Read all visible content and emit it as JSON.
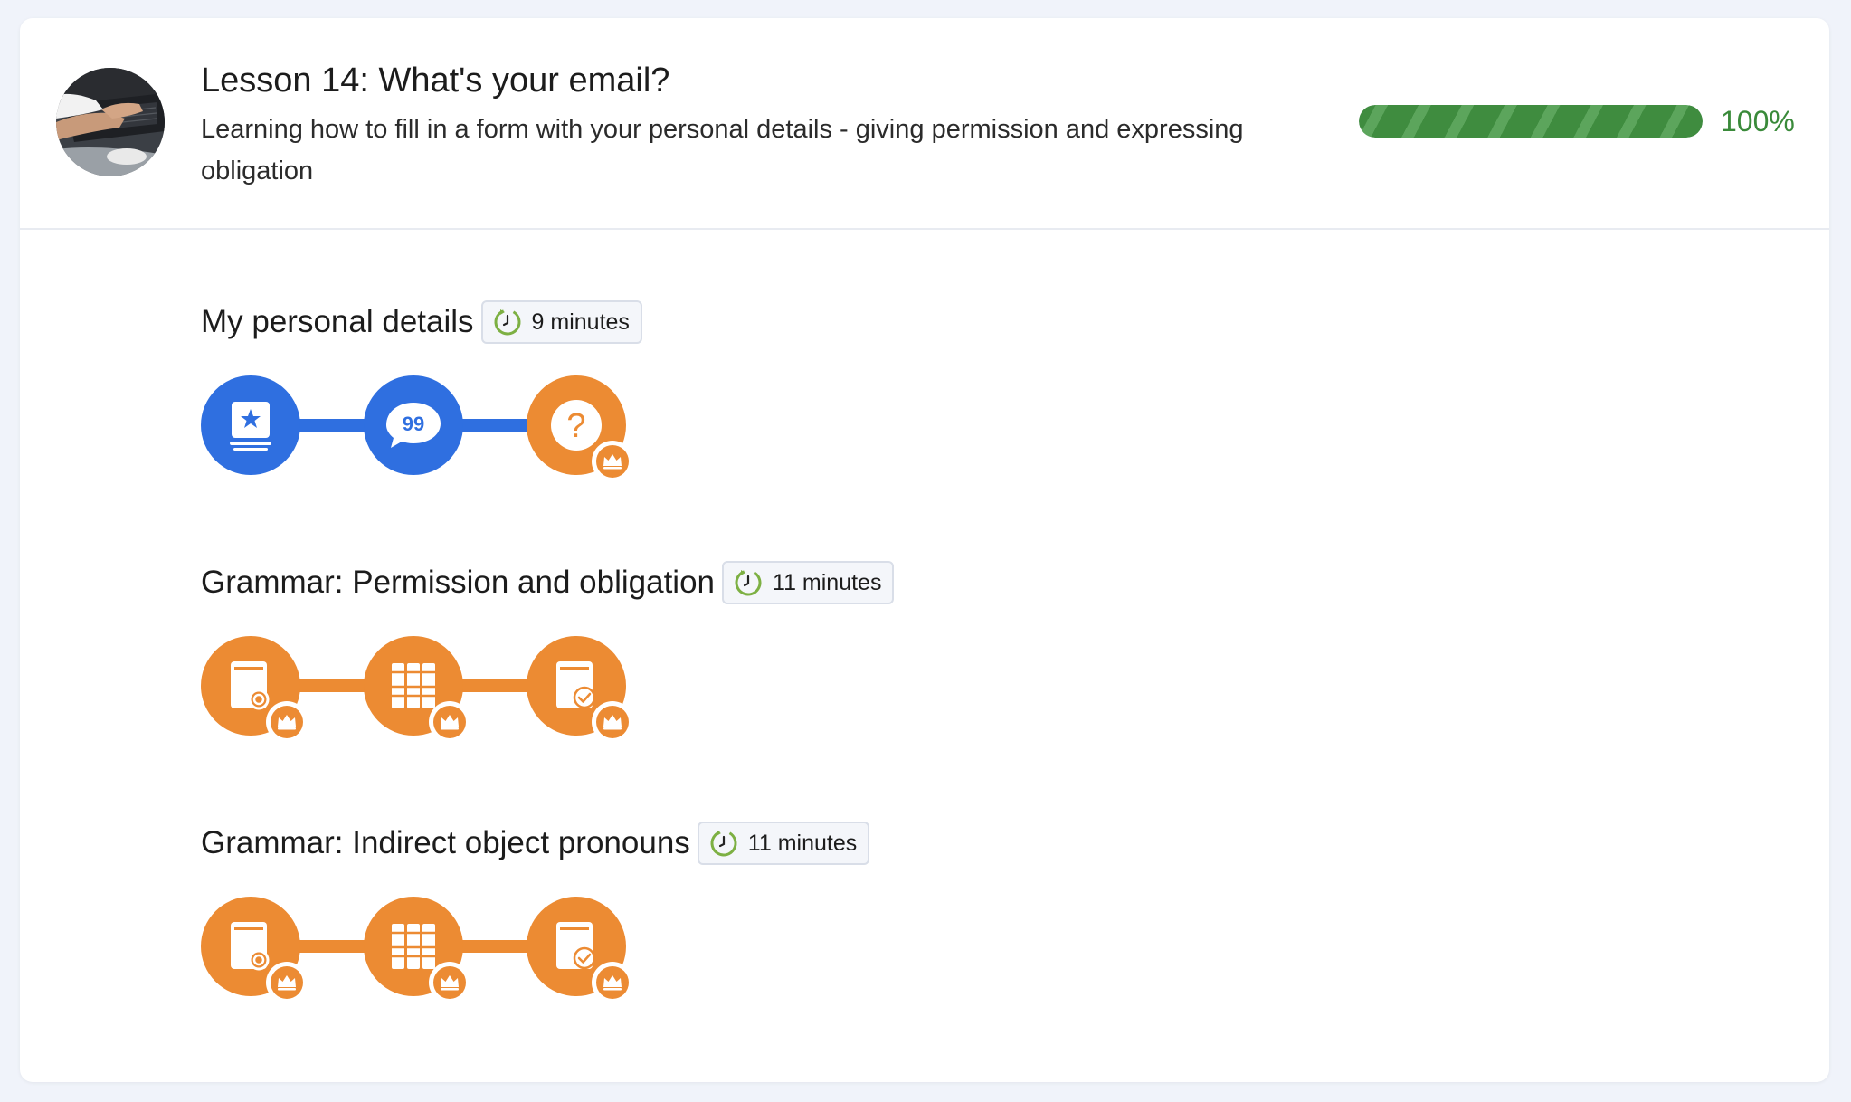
{
  "colors": {
    "blue": "#2f6fe0",
    "orange": "#ec8b33",
    "green": "#3f8c3f",
    "clock_green": "#7db043"
  },
  "lesson": {
    "title": "Lesson 14: What's your email?",
    "description": "Learning how to fill in a form with your personal details - giving permission and expressing obligation",
    "progress_percent": 100,
    "progress_label": "100%"
  },
  "sections": [
    {
      "title": "My personal details",
      "duration": "9 minutes",
      "activities": [
        {
          "icon": "flashcard-star-icon",
          "state": "completed"
        },
        {
          "icon": "speech-bubble-quote-icon",
          "state": "completed"
        },
        {
          "icon": "question-mark-icon",
          "state": "mastered",
          "badge": "crown-icon"
        }
      ]
    },
    {
      "title": "Grammar: Permission and obligation",
      "duration": "11 minutes",
      "activities": [
        {
          "icon": "book-search-icon",
          "state": "mastered",
          "badge": "crown-icon"
        },
        {
          "icon": "books-shelf-icon",
          "state": "mastered",
          "badge": "crown-icon"
        },
        {
          "icon": "book-check-icon",
          "state": "mastered",
          "badge": "crown-icon"
        }
      ]
    },
    {
      "title": "Grammar: Indirect object pronouns",
      "duration": "11 minutes",
      "activities": [
        {
          "icon": "book-search-icon",
          "state": "mastered",
          "badge": "crown-icon"
        },
        {
          "icon": "books-shelf-icon",
          "state": "mastered",
          "badge": "crown-icon"
        },
        {
          "icon": "book-check-icon",
          "state": "mastered",
          "badge": "crown-icon"
        }
      ]
    }
  ]
}
